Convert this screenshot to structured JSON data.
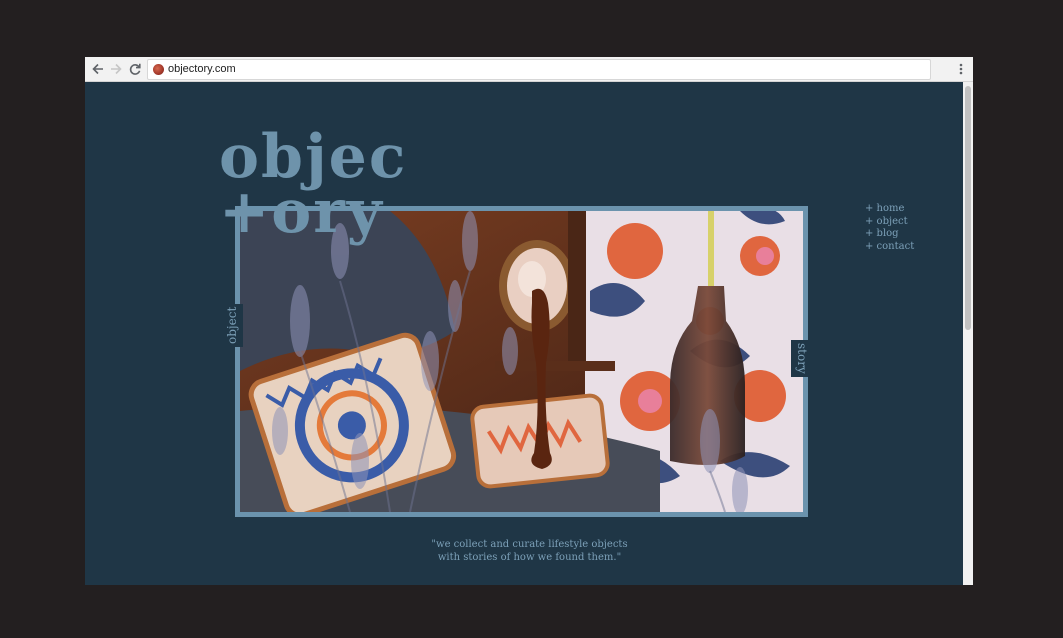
{
  "browser": {
    "url": "objectory.com",
    "back_icon": "arrow-left-icon",
    "forward_icon": "arrow-right-icon",
    "reload_icon": "reload-icon",
    "menu_icon": "kebab-menu-icon"
  },
  "site": {
    "logo_line1": "objec",
    "logo_line2": "+ory",
    "side_left": "object",
    "side_right": "story",
    "nav": [
      "+ home",
      "+ object",
      "+ blog",
      "+ contact"
    ],
    "tagline_line1": "\"we collect and curate lifestyle objects",
    "tagline_line2": "with stories of how we found them.\""
  },
  "colors": {
    "page_bg": "#1f3646",
    "accent": "#6b93ad",
    "text": "#7ca0b8"
  }
}
